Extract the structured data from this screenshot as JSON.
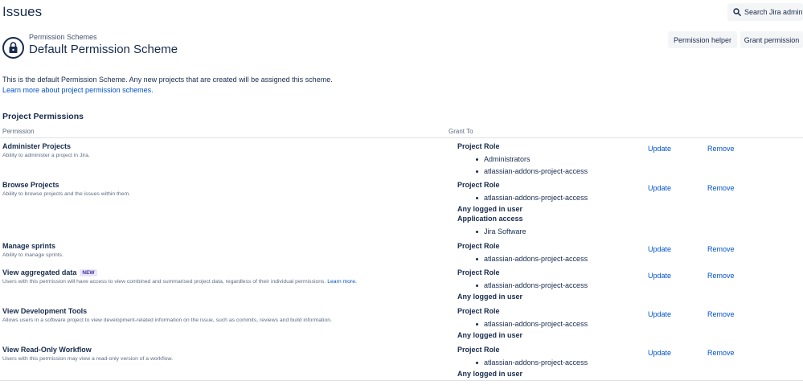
{
  "header": {
    "title": "Issues",
    "search_button": "Search Jira admin"
  },
  "scheme": {
    "breadcrumb": "Permission Schemes",
    "title": "Default Permission Scheme",
    "icon": "lock-icon",
    "helper_button": "Permission helper",
    "grant_button": "Grant permission"
  },
  "intro": {
    "description": "This is the default Permission Scheme. Any new projects that are created will be assigned this scheme.",
    "learn_more": "Learn more about project permission schemes."
  },
  "section": {
    "title": "Project Permissions",
    "col_permission": "Permission",
    "col_grant": "Grant To"
  },
  "actions": {
    "update": "Update",
    "remove": "Remove"
  },
  "permissions": [
    {
      "name": "Administer Projects",
      "description": "Ability to administer a project in Jira.",
      "grants": [
        {
          "type": "Project Role",
          "items": [
            "Administrators",
            "atlassian-addons-project-access"
          ]
        }
      ]
    },
    {
      "name": "Browse Projects",
      "description": "Ability to browse projects and the issues within them.",
      "grants": [
        {
          "type": "Project Role",
          "items": [
            "atlassian-addons-project-access"
          ]
        },
        {
          "type": "Any logged in user",
          "items": []
        },
        {
          "type": "Application access",
          "items": [
            "Jira Software"
          ]
        }
      ]
    },
    {
      "name": "Manage sprints",
      "description": "Ability to manage sprints.",
      "grants": [
        {
          "type": "Project Role",
          "items": [
            "atlassian-addons-project-access"
          ]
        }
      ]
    },
    {
      "name": "View aggregated data",
      "badge": "NEW",
      "description": "Users with this permission will have access to view combined and summarised project data, regardless of their individual permissions.",
      "description_link": "Learn more.",
      "grants": [
        {
          "type": "Project Role",
          "items": [
            "atlassian-addons-project-access"
          ]
        },
        {
          "type": "Any logged in user",
          "items": []
        }
      ]
    },
    {
      "name": "View Development Tools",
      "description": "Allows users in a software project to view development-related information on the issue, such as commits, reviews and build information.",
      "grants": [
        {
          "type": "Project Role",
          "items": [
            "atlassian-addons-project-access"
          ]
        },
        {
          "type": "Any logged in user",
          "items": []
        }
      ]
    },
    {
      "name": "View Read-Only Workflow",
      "description": "Users with this permission may view a read-only version of a workflow.",
      "grants": [
        {
          "type": "Project Role",
          "items": [
            "atlassian-addons-project-access"
          ]
        },
        {
          "type": "Any logged in user",
          "items": []
        }
      ]
    }
  ],
  "colors": {
    "link": "#0052cc",
    "text": "#172b4d",
    "subtle": "#5e6c84",
    "button_bg": "#f4f5f7"
  }
}
